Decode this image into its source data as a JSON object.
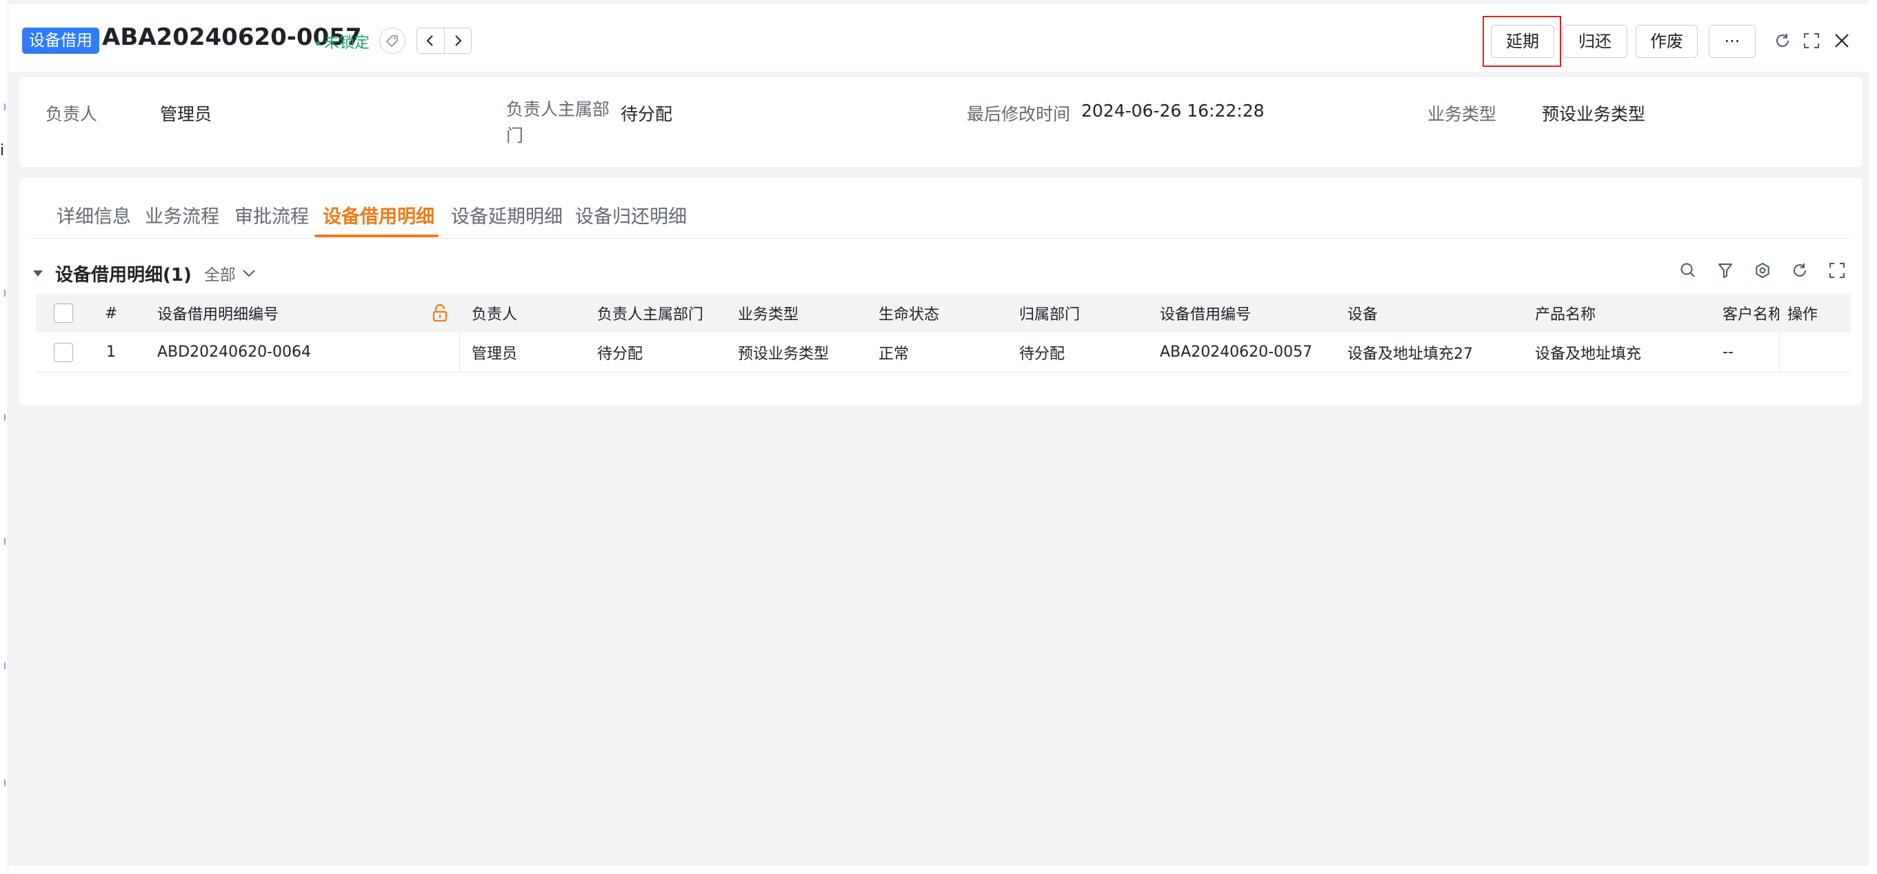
{
  "header": {
    "module_tag": "设备借用",
    "doc_number": "ABA20240620-0057",
    "lock_status": "未锁定",
    "actions": {
      "extend": "延期",
      "return": "归还",
      "void": "作废",
      "more": "···"
    }
  },
  "info": [
    {
      "label": "负责人",
      "value": "管理员"
    },
    {
      "label_line1": "负责人主属部",
      "label_line2": "门",
      "value": "待分配"
    },
    {
      "label": "最后修改时间",
      "value": "2024-06-26 16:22:28"
    },
    {
      "label": "业务类型",
      "value": "预设业务类型"
    }
  ],
  "tabs": [
    "详细信息",
    "业务流程",
    "审批流程",
    "设备借用明细",
    "设备延期明细",
    "设备归还明细"
  ],
  "active_tab": "设备借用明细",
  "section": {
    "title": "设备借用明细(1)",
    "filter": "全部"
  },
  "table": {
    "columns": [
      "#",
      "设备借用明细编号",
      "负责人",
      "负责人主属部门",
      "业务类型",
      "生命状态",
      "归属部门",
      "设备借用编号",
      "设备",
      "产品名称",
      "客户名称",
      "操作"
    ],
    "rows": [
      {
        "index": "1",
        "detail_no": "ABD20240620-0064",
        "owner": "管理员",
        "owner_dept": "待分配",
        "biz_type": "预设业务类型",
        "life_status": "正常",
        "dept": "待分配",
        "borrow_no": "ABA20240620-0057",
        "device": "设备及地址填充27",
        "product": "设备及地址填充",
        "customer": "--",
        "operation": ""
      }
    ]
  },
  "colors": {
    "accent": "#f27a1a",
    "primary": "#2f7cf6",
    "link": "#2f6ee8",
    "lock_ok": "#1fa463",
    "highlight": "#e02020"
  },
  "icons": [
    "tag-icon",
    "chevron-left-icon",
    "chevron-right-icon",
    "refresh-icon",
    "fullscreen-icon",
    "close-icon",
    "search-icon",
    "filter-icon",
    "settings-icon",
    "lock-icon",
    "caret-down-icon",
    "chevron-down-icon"
  ]
}
